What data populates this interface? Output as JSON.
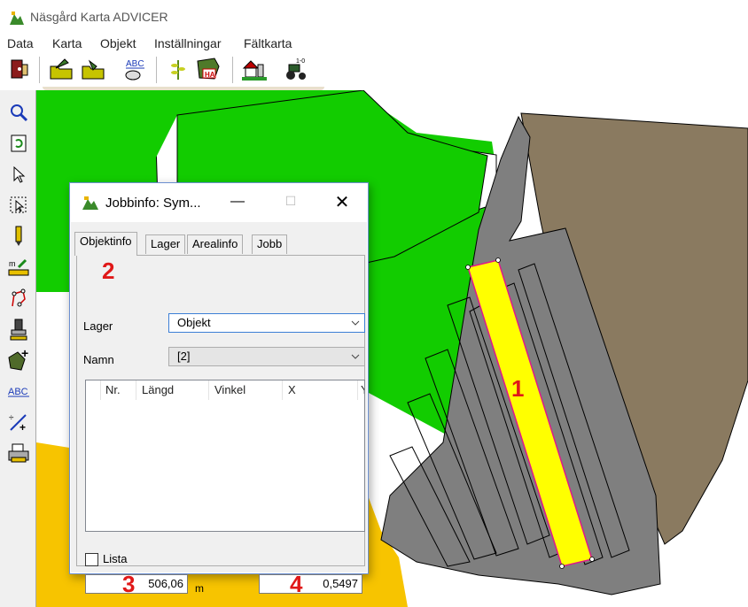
{
  "app": {
    "title": "Näsgård Karta ADVICER"
  },
  "menu": [
    "Data",
    "Karta",
    "Objekt",
    "Inställningar",
    "Fältkarta"
  ],
  "toolbar_icons": [
    "exit-icon",
    "open-folder-icon",
    "save-folder-icon",
    "spellcheck-abc-icon",
    "crop-icon",
    "field-ha-icon",
    "farm-icon",
    "tractor-icon"
  ],
  "left_tools": [
    "zoom-icon",
    "refresh-icon",
    "pointer-icon",
    "select-icon",
    "pencil-icon",
    "measure-icon",
    "polygon-icon",
    "stamp-icon",
    "add-area-icon",
    "text-icon",
    "split-line-icon",
    "print-icon"
  ],
  "dialog": {
    "title": "Jobbinfo: Sym...",
    "tabs": [
      "Objektinfo",
      "Lager",
      "Arealinfo",
      "Jobb"
    ],
    "active_tab": "Objektinfo",
    "lager_label": "Lager",
    "lager_value": "Objekt",
    "namn_label": "Namn",
    "namn_value": "[2]",
    "columns": [
      "Nr.",
      "Längd",
      "Vinkel",
      "X",
      "Y"
    ],
    "lista_label": "Lista",
    "lista_checked": false,
    "length_value": "506,06",
    "length_unit": "m",
    "second_value": "0,5497"
  },
  "annotations": {
    "a1": "1",
    "a2": "2",
    "a3": "3",
    "a4": "4"
  },
  "colors": {
    "green": "#12cc00",
    "gray": "#7f7f7f",
    "brown": "#8a7a60",
    "yellow": "#ffff00",
    "orange": "#f7c400",
    "annot": "#e01818"
  }
}
